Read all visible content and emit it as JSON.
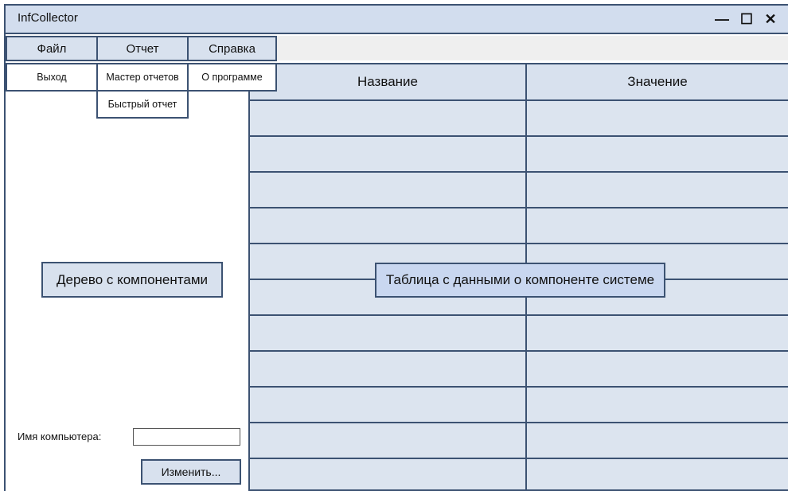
{
  "window": {
    "title": "InfCollector",
    "controls": {
      "minimize": "—",
      "maximize": "☐",
      "close": "✕"
    }
  },
  "menu": {
    "file": {
      "label": "Файл",
      "items": [
        "Выход"
      ]
    },
    "report": {
      "label": "Отчет",
      "items": [
        "Мастер отчетов",
        "Быстрый отчет"
      ]
    },
    "help": {
      "label": "Справка",
      "items": [
        "О программе"
      ]
    }
  },
  "left_panel": {
    "tree_label": "Дерево с компонентами",
    "computer_name_label": "Имя компьютера:",
    "computer_name_value": "",
    "change_button": "Изменить..."
  },
  "table": {
    "columns": [
      "Название",
      "Значение"
    ],
    "overlay_label": "Таблица с данными о компоненте системе"
  }
}
